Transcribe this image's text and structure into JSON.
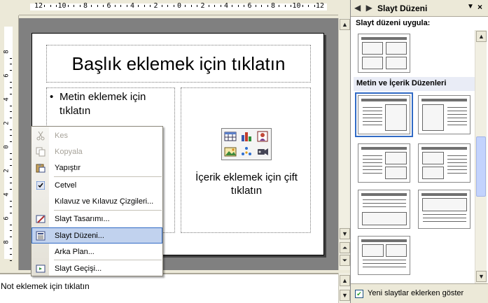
{
  "editor": {
    "ruler_labels": [
      "12",
      "10",
      "8",
      "6",
      "4",
      "2",
      "0",
      "2",
      "4",
      "6",
      "8",
      "10",
      "12"
    ],
    "vruler_labels": [
      "8",
      "6",
      "4",
      "2",
      "0",
      "2",
      "4",
      "6",
      "8"
    ],
    "slide": {
      "title_placeholder": "Başlık eklemek için tıklatın",
      "text_placeholder": "Metin eklemek için tıklatın",
      "bullet": "•",
      "content_placeholder": "İçerik eklemek için çift tıklatın"
    },
    "notes_placeholder": "Not eklemek için tıklatın"
  },
  "context_menu": {
    "items": [
      {
        "label": "Kes",
        "icon": "scissors-icon",
        "enabled": false
      },
      {
        "label": "Kopyala",
        "icon": "copy-icon",
        "enabled": false
      },
      {
        "label": "Yapıştır",
        "icon": "paste-icon",
        "enabled": true
      },
      {
        "label": "Cetvel",
        "icon": "check-icon",
        "enabled": true,
        "checked": true
      },
      {
        "label": "Kılavuz ve Kılavuz Çizgileri...",
        "icon": "",
        "enabled": true
      },
      {
        "label": "Slayt Tasarımı...",
        "icon": "slide-design-icon",
        "enabled": true
      },
      {
        "label": "Slayt Düzeni...",
        "icon": "slide-layout-icon",
        "enabled": true,
        "highlighted": true
      },
      {
        "label": "Arka Plan...",
        "icon": "",
        "enabled": true
      },
      {
        "label": "Slayt Geçişi...",
        "icon": "slide-transition-icon",
        "enabled": true
      }
    ]
  },
  "task_pane": {
    "title": "Slayt Düzeni",
    "nav": "◀ ▶",
    "apply_label": "Slayt düzeni uygula:",
    "section_label": "Metin ve İçerik Düzenleri",
    "footer_checkbox_label": "Yeni slaytlar eklerken göster",
    "footer_checked": true
  },
  "colors": {
    "selection": "#316ac5",
    "highlight": "#c1d2ee",
    "chrome": "#ece9d8"
  }
}
